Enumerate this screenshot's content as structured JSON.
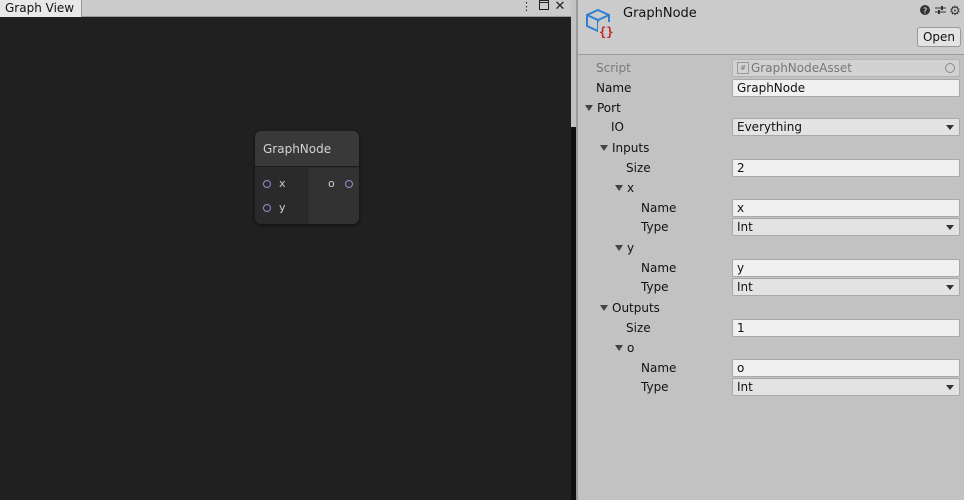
{
  "graph_view": {
    "tab_label": "Graph View",
    "node": {
      "title": "GraphNode",
      "inputs": [
        "x",
        "y"
      ],
      "outputs": [
        "o"
      ]
    }
  },
  "inspector": {
    "title": "GraphNode",
    "open_label": "Open",
    "script_label": "Script",
    "script_value": "GraphNodeAsset",
    "name_label": "Name",
    "name_value": "GraphNode",
    "port_label": "Port",
    "io_label": "IO",
    "io_value": "Everything",
    "inputs_label": "Inputs",
    "inputs_size_label": "Size",
    "inputs_size_value": "2",
    "inputs": [
      {
        "element": "x",
        "name_label": "Name",
        "name_value": "x",
        "type_label": "Type",
        "type_value": "Int"
      },
      {
        "element": "y",
        "name_label": "Name",
        "name_value": "y",
        "type_label": "Type",
        "type_value": "Int"
      }
    ],
    "outputs_label": "Outputs",
    "outputs_size_label": "Size",
    "outputs_size_value": "1",
    "outputs": [
      {
        "element": "o",
        "name_label": "Name",
        "name_value": "o",
        "type_label": "Type",
        "type_value": "Int"
      }
    ]
  },
  "colors": {
    "graph_background": "#202020",
    "node_body": "#2c2c2c",
    "port_outline": "#8f8fd6",
    "inspector_background": "#c2c2c2",
    "asset_icon_blue": "#2f7fd3",
    "asset_icon_red": "#c0282a"
  },
  "icons": [
    "kebab-menu-icon",
    "maximize-icon",
    "close-icon",
    "help-icon",
    "preset-icon",
    "gear-icon",
    "script-asset-icon",
    "object-picker-icon"
  ]
}
